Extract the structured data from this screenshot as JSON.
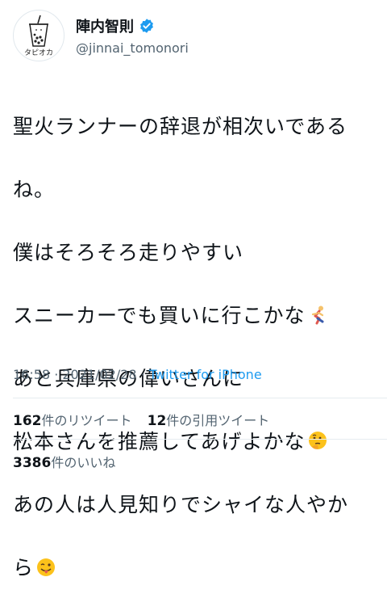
{
  "user": {
    "display_name": "陣内智則",
    "handle": "@jinnai_tomonori",
    "verified": true,
    "avatar_caption": "タピオカ"
  },
  "tweet": {
    "lines": [
      "聖火ランナーの辞退が相次いである",
      "ね。",
      "僕はそろそろ走りやすい",
      "スニーカーでも買いに行こかな",
      "あと兵庫県の偉いさんに",
      "松本さんを推薦してあげよかな",
      "あの人は人見知りでシャイな人やか",
      "ら"
    ],
    "emojis": {
      "line4": "running-person-emoji",
      "line6": "thinking-face-emoji",
      "line8": "winking-tongue-face-emoji"
    }
  },
  "meta": {
    "time": "16:58",
    "sep": " · ",
    "date": "2021/02/28",
    "source": "Twitter for iPhone"
  },
  "stats": {
    "retweets_count": "162",
    "retweets_label": "件のリツイート",
    "quotes_count": "12",
    "quotes_label": "件の引用ツイート",
    "likes_count": "3386",
    "likes_label": "件のいいね"
  },
  "colors": {
    "accent": "#1d9bf0",
    "text": "#0f1419",
    "muted": "#536471"
  }
}
